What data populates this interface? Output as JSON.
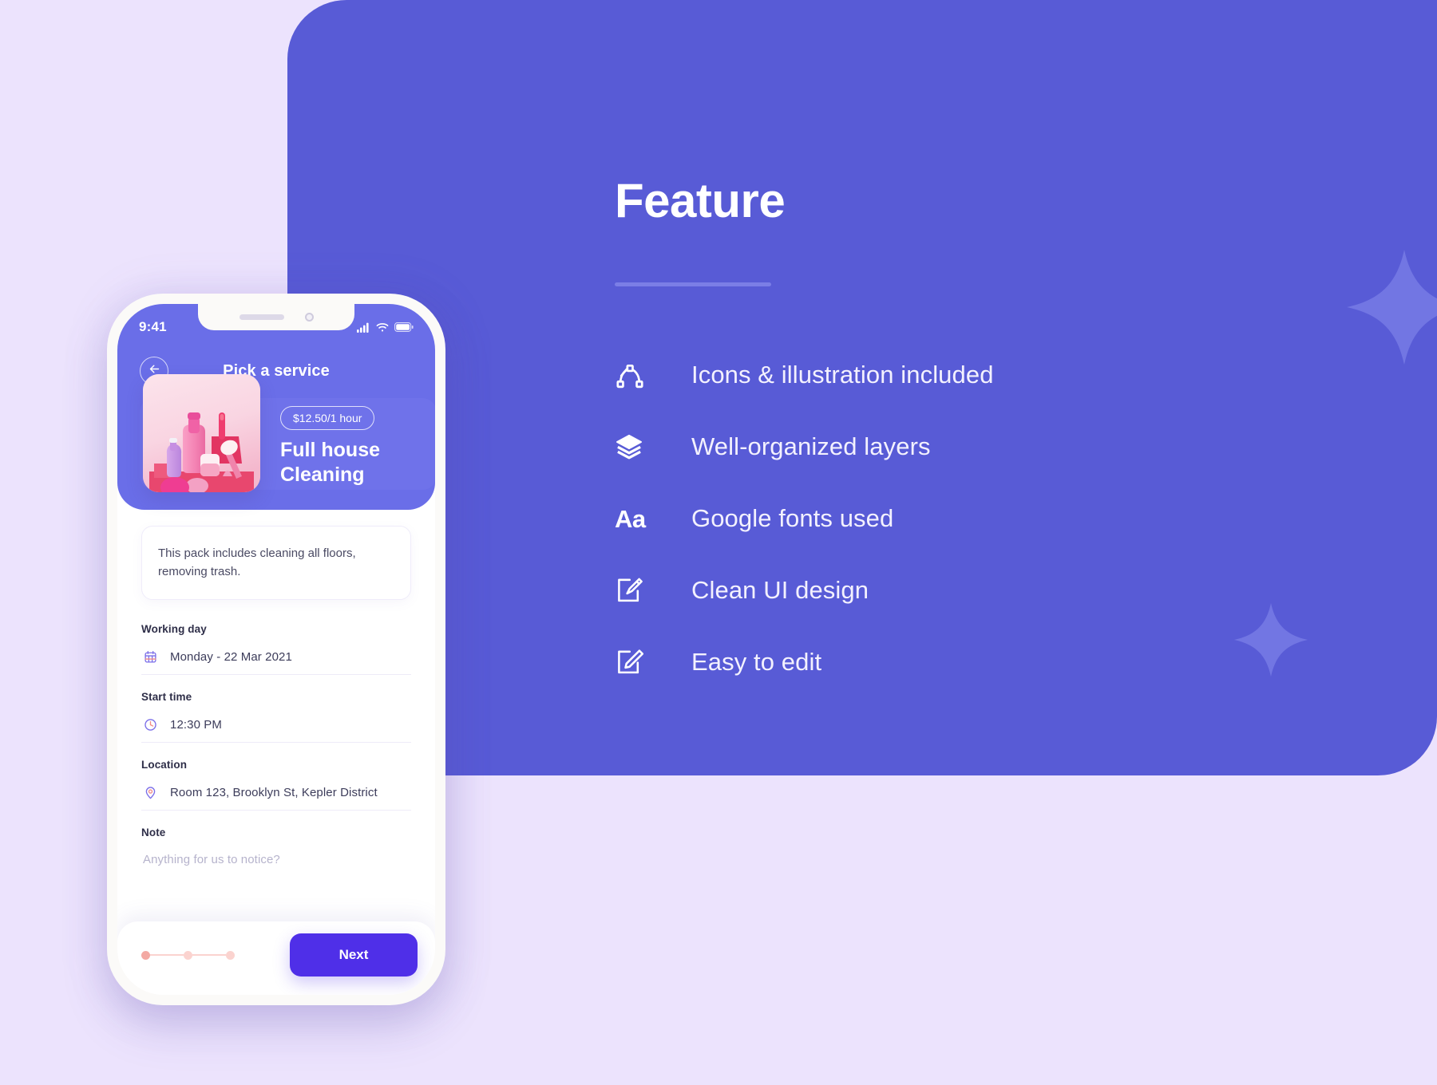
{
  "theme": {
    "page_background": "#ece3fd",
    "panel_purple": "#585bd6",
    "panel_sparkle": "#7276e3",
    "app_header_purple": "#6a6ee8",
    "card_purple": "#6f72ea",
    "next_button": "#4f2fe8",
    "dot_active": "#f3a9a3",
    "dot_inactive": "#fbd3cf"
  },
  "feature_panel": {
    "title": "Feature",
    "items": [
      {
        "icon": "pen-tool-icon",
        "label": "Icons & illustration included"
      },
      {
        "icon": "layers-icon",
        "label": "Well-organized layers"
      },
      {
        "icon": "typography-icon",
        "icon_text": "Aa",
        "label": "Google fonts used"
      },
      {
        "icon": "brush-edit-icon",
        "label": "Clean UI design"
      },
      {
        "icon": "pencil-edit-icon",
        "label": "Easy to edit"
      }
    ]
  },
  "phone": {
    "status_bar": {
      "time": "9:41",
      "icons": [
        "cellular-signal-icon",
        "wifi-icon",
        "battery-icon"
      ]
    },
    "nav": {
      "back_icon": "arrow-left-icon",
      "title": "Pick a service"
    },
    "service_card": {
      "price": "$12.50/1 hour",
      "name_line1": "Full house",
      "name_line2": "Cleaning",
      "thumbnail": "cleaning-products-photo"
    },
    "description": "This pack includes cleaning all floors, removing trash.",
    "fields": [
      {
        "label": "Working day",
        "icon": "calendar-icon",
        "value": "Monday - 22 Mar 2021",
        "is_placeholder": false
      },
      {
        "label": "Start time",
        "icon": "clock-icon",
        "value": "12:30 PM",
        "is_placeholder": false
      },
      {
        "label": "Location",
        "icon": "map-pin-icon",
        "value": "Room 123, Brooklyn St, Kepler District",
        "is_placeholder": false
      },
      {
        "label": "Note",
        "icon": "",
        "value": "Anything for us to notice?",
        "is_placeholder": true
      }
    ],
    "bottom_bar": {
      "next_label": "Next",
      "step_dots": 3,
      "active_step": 1
    }
  }
}
